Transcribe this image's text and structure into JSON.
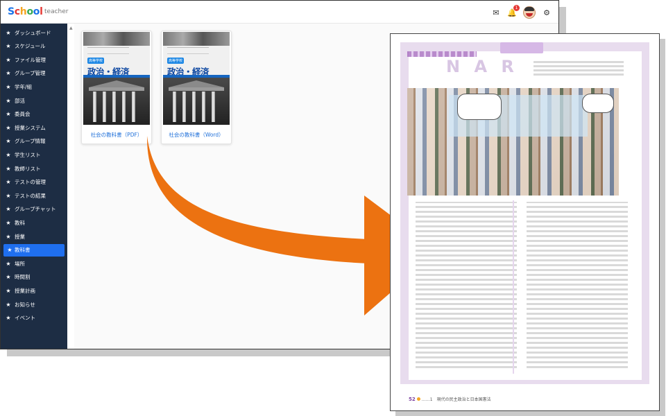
{
  "app": {
    "logo": [
      "S",
      "c",
      "h",
      "o",
      "o",
      "l"
    ],
    "user_role": "teacher",
    "notifications_count": "1"
  },
  "sidebar": {
    "items": [
      {
        "label": "ダッシュボード"
      },
      {
        "label": "スケジュール"
      },
      {
        "label": "ファイル管理"
      },
      {
        "label": "グループ管理"
      },
      {
        "label": "学年/組"
      },
      {
        "label": "部活"
      },
      {
        "label": "委員会"
      },
      {
        "label": "授業システム"
      },
      {
        "label": "グループ情報"
      },
      {
        "label": "学生リスト"
      },
      {
        "label": "教師リスト"
      },
      {
        "label": "テストの管理"
      },
      {
        "label": "テストの結果"
      },
      {
        "label": "グループチャット"
      },
      {
        "label": "教科"
      },
      {
        "label": "授業"
      },
      {
        "label": "教科書"
      },
      {
        "label": "場所"
      },
      {
        "label": "時間割"
      },
      {
        "label": "授業計画"
      },
      {
        "label": "お知らせ"
      },
      {
        "label": "イベント"
      }
    ],
    "active_index": 16
  },
  "textbooks": [
    {
      "cover_badge": "高等学校",
      "cover_title": "政治・経済",
      "label": "社会の教科書（PDF）"
    },
    {
      "cover_badge": "高等学校",
      "cover_title": "政治・経済",
      "label": "社会の教科書（Word）"
    }
  ],
  "preview": {
    "title_letters": "N  A  R",
    "footer_page": "52",
    "footer_text": "……1　現代の民主政治と日本国憲法"
  },
  "colors": {
    "sidebar_bg": "#1d2d44",
    "active_item": "#1f6fef",
    "link": "#1e6fd9",
    "arrow": "#ec7211",
    "page_accent": "#e8dcee"
  }
}
